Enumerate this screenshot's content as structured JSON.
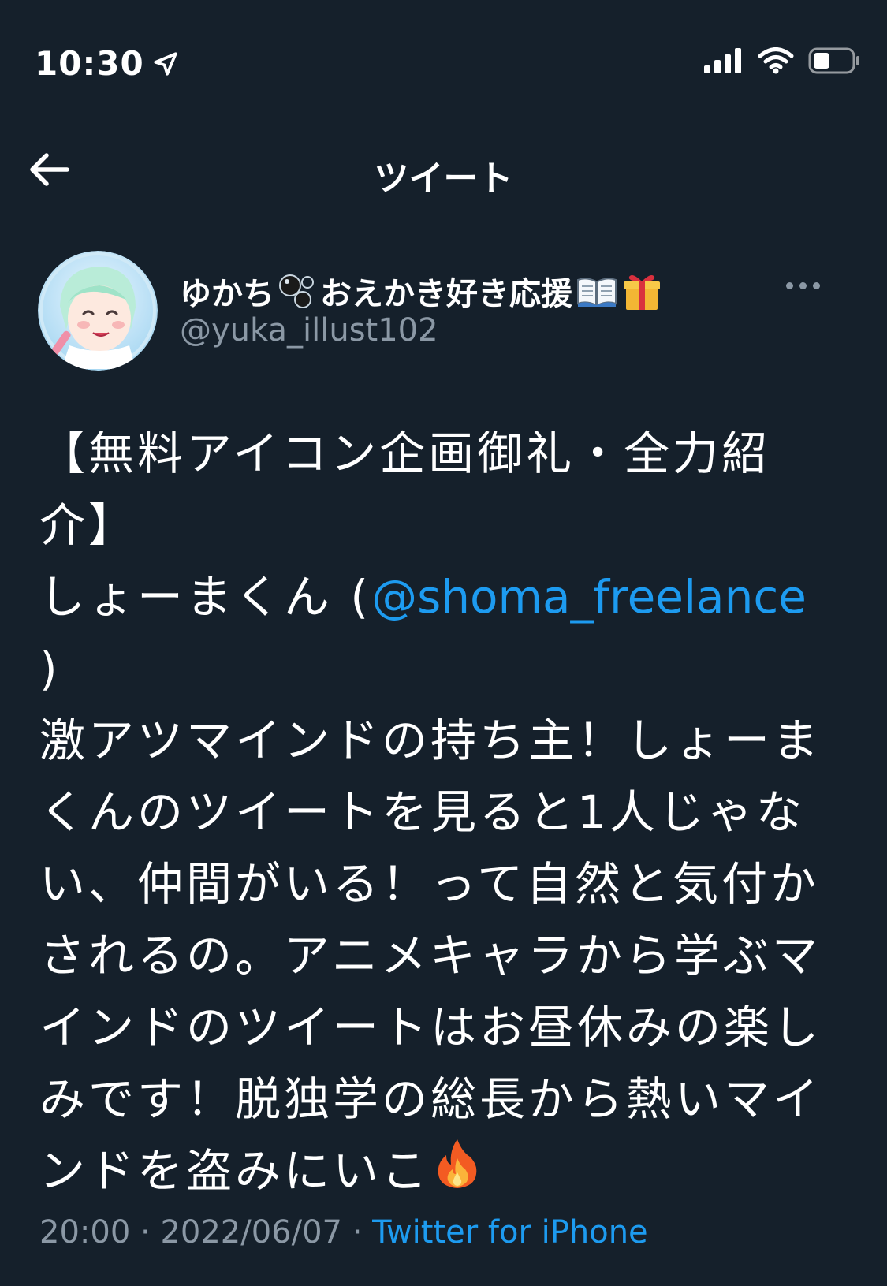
{
  "status_bar": {
    "time": "10:30",
    "icons": [
      "location-arrow-icon",
      "cellular-signal-icon",
      "wifi-icon",
      "battery-icon"
    ]
  },
  "nav": {
    "title": "ツイート",
    "back_icon": "arrow-left-icon"
  },
  "author": {
    "name": "ゆかち",
    "name_suffix": "おえかき好き応援",
    "name_emojis": [
      "bubbles-icon",
      "open-book-icon",
      "gift-icon"
    ],
    "handle": "@yuka_illust102",
    "more_icon": "more-horizontal-icon"
  },
  "tweet": {
    "text_before_mention": "【無料アイコン企画御礼・全力紹介】\nしょーまくん (",
    "mention": "@shoma_freelance",
    "text_after_mention": " )\n激アツマインドの持ち主！しょーまくんのツイートを見ると1人じゃない、仲間がいる！って自然と気付かされるの。アニメキャラから学ぶマインドのツイートはお昼休みの楽しみです！脱独学の総長から熱いマインドを盗みにいこ",
    "trailing_emoji": "fire-icon"
  },
  "meta": {
    "time": "20:00",
    "separator": " · ",
    "date": "2022/06/07",
    "source": "Twitter for iPhone"
  },
  "colors": {
    "background": "#15202b",
    "text": "#ffffff",
    "secondary": "#8b98a5",
    "accent": "#1d9bf0"
  }
}
